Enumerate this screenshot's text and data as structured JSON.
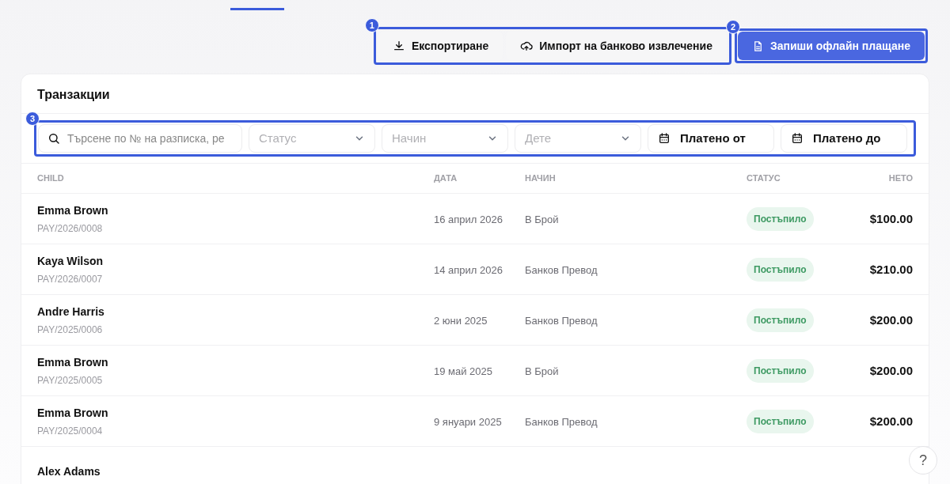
{
  "tab_indicator": {
    "selected": true
  },
  "actions_marker": "1",
  "actions": [
    {
      "kind": "export",
      "label": "Експортиране"
    },
    {
      "kind": "import",
      "label": "Импорт на банково извлечение"
    }
  ],
  "primary_action": {
    "label": "Запиши офлайн плащане",
    "marker": "2"
  },
  "card": {
    "title": "Транзакции"
  },
  "filters": {
    "marker": "3",
    "items": [
      {
        "kind": "search",
        "placeholder": "Търсене по № на разписка, ре"
      },
      {
        "kind": "select",
        "placeholder": "Статус"
      },
      {
        "kind": "select",
        "placeholder": "Начин"
      },
      {
        "kind": "select",
        "placeholder": "Дете"
      },
      {
        "kind": "date",
        "label": "Платено от"
      },
      {
        "kind": "date",
        "label": "Платено до"
      }
    ]
  },
  "table": {
    "columns": [
      "CHILD",
      "ДАТА",
      "НАЧИН",
      "СТАТУС",
      "НЕТО"
    ],
    "rows": [
      {
        "child": "Emma Brown",
        "receipt": "PAY/2026/0008",
        "date": "16 април 2026",
        "method": "В Брой",
        "status": "Постъпило",
        "net": "$100.00"
      },
      {
        "child": "Kaya Wilson",
        "receipt": "PAY/2026/0007",
        "date": "14 април 2026",
        "method": "Банков Превод",
        "status": "Постъпило",
        "net": "$210.00"
      },
      {
        "child": "Andre Harris",
        "receipt": "PAY/2025/0006",
        "date": "2 юни 2025",
        "method": "Банков Превод",
        "status": "Постъпило",
        "net": "$200.00"
      },
      {
        "child": "Emma Brown",
        "receipt": "PAY/2025/0005",
        "date": "19 май 2025",
        "method": "В Брой",
        "status": "Постъпило",
        "net": "$200.00"
      },
      {
        "child": "Emma Brown",
        "receipt": "PAY/2025/0004",
        "date": "9 януари 2025",
        "method": "Банков Превод",
        "status": "Постъпило",
        "net": "$200.00"
      },
      {
        "child": "Alex Adams"
      }
    ]
  },
  "help": {
    "label": "?"
  }
}
